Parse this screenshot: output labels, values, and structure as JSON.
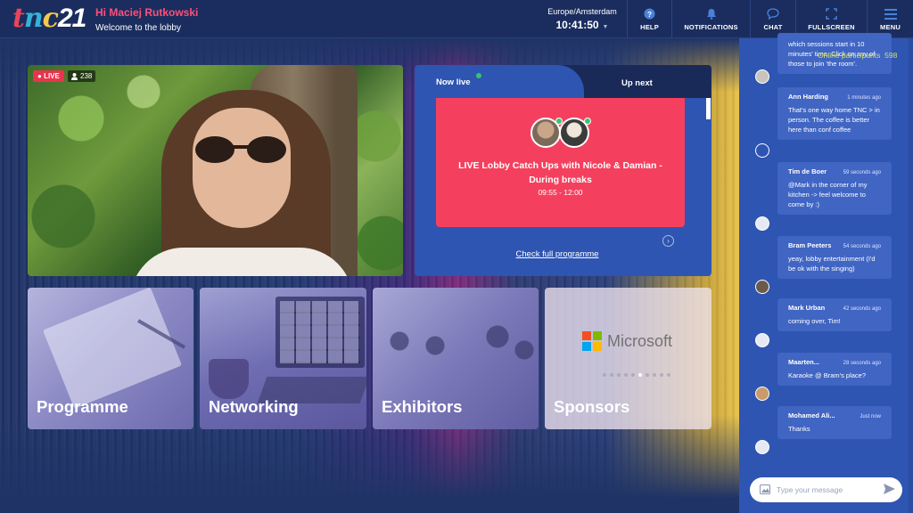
{
  "header": {
    "logo": {
      "p1": "t",
      "p2": "n",
      "p3": "c",
      "p4": "21"
    },
    "greeting": "Hi Maciej Rutkowski",
    "subtitle": "Welcome to the lobby",
    "timezone": "Europe/Amsterdam",
    "time": "10:41:50",
    "nav": [
      {
        "label": "HELP",
        "icon": "help-icon"
      },
      {
        "label": "NOTIFICATIONS",
        "icon": "bell-icon"
      },
      {
        "label": "CHAT",
        "icon": "chat-bubble-icon"
      },
      {
        "label": "FULLSCREEN",
        "icon": "fullscreen-icon"
      },
      {
        "label": "MENU",
        "icon": "hamburger-icon"
      }
    ]
  },
  "video": {
    "live_label": "LIVE",
    "viewers": "238"
  },
  "panel": {
    "tab_now": "Now live",
    "tab_next": "Up next",
    "session_title": "LIVE Lobby Catch Ups with Nicole & Damian - During breaks",
    "session_time": "09:55 - 12:00",
    "link": "Check full programme"
  },
  "tiles": [
    {
      "label": "Programme"
    },
    {
      "label": "Networking"
    },
    {
      "label": "Exhibitors"
    },
    {
      "label": "Sponsors"
    }
  ],
  "sponsor": {
    "name": "Microsoft"
  },
  "colors": {
    "accent_pink": "#f4405e",
    "panel_blue": "#2e55b2",
    "header_navy": "#1a2d5e",
    "online_green": "#36c46b"
  },
  "chat": {
    "online_label": "Online participants",
    "online_count": "598",
    "messages": [
      {
        "name": "",
        "ago": "",
        "text": "which sessions start in 10 minutes' time. Click on any of those to join 'the room'."
      },
      {
        "name": "Ann Harding",
        "ago": "1 minutes ago",
        "text": "That's one way home TNC > in person. The coffee is better here than conf coffee"
      },
      {
        "name": "Tim de Boer",
        "ago": "59 seconds ago",
        "text": "@Mark in the corner of my kitchen -> feel welcome to come by :)"
      },
      {
        "name": "Bram Peeters",
        "ago": "54 seconds ago",
        "text": "yeay, lobby entertainment (I'd be ok with the singing)"
      },
      {
        "name": "Mark Urban",
        "ago": "42 seconds ago",
        "text": "coming over, Tim!"
      },
      {
        "name": "Maarten...",
        "ago": "28 seconds ago",
        "text": "Karaoke @ Bram's place?"
      },
      {
        "name": "Mohamed Ali...",
        "ago": "Just now",
        "text": "Thanks"
      }
    ],
    "placeholder": "Type your message"
  }
}
